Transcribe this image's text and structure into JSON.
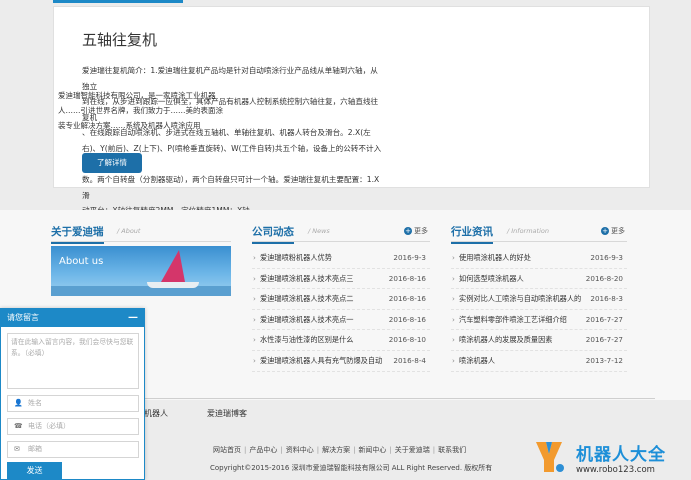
{
  "product": {
    "title": "五轴往复机",
    "description": "爱迪瑞往复机简介：1.爱迪瑞往复机产品均是针对自动喷涂行业产品线从单轴到六轴，从独立\n到在线，从步进到跟踪一应俱全，具体产品有机器人控制系统控制六轴往复，六轴直线往复机\n、在线跟踪自动喷涂机、步进式在线五轴机、单轴往复机、机器人转台及滑台。2.X(左\n右)、Y(前后)、Z(上下)、P(喷枪垂直旋转)、W(工件自转)共五个轴，设备上的公转不计入轴\n数。两个自转盘（分割器驱动），两个自转盘只可计一个轴。爱迪瑞往复机主要配置：1.X滑\n动平台：X轴往复精度2MM，定位精度1MM；X轴...",
    "button": "了解详情"
  },
  "columns": {
    "about": {
      "title": "关于爱迪瑞",
      "en": "/ About",
      "image_caption": "About us",
      "text": "爱迪瑞智能科技有限公司，是一家喷涂工业机器人……引进世界名牌，我们致力于……美的表面涂装专业解决方案……系统及机器人喷涂应用"
    },
    "company_news": {
      "title": "公司动态",
      "en": "/ News",
      "more": "更多",
      "items": [
        {
          "title": "爱迪瑞喷粉机器人优势",
          "date": "2016-9-3"
        },
        {
          "title": "爱迪瑞喷涂机器人技术亮点三",
          "date": "2016-8-16"
        },
        {
          "title": "爱迪瑞喷涂机器人技术亮点二",
          "date": "2016-8-16"
        },
        {
          "title": "爱迪瑞喷涂机器人技术亮点一",
          "date": "2016-8-16"
        },
        {
          "title": "水性漆与油性漆的区别是什么",
          "date": "2016-8-10"
        },
        {
          "title": "爱迪瑞喷涂机器人具有充气防爆及自动",
          "date": "2016-8-4"
        }
      ]
    },
    "industry_news": {
      "title": "行业资讯",
      "en": "/ Information",
      "more": "更多",
      "items": [
        {
          "title": "使用喷涂机器人的好处",
          "date": "2016-9-3"
        },
        {
          "title": "如何选型喷涂机器人",
          "date": "2016-8-20"
        },
        {
          "title": "实例对比人工喷涂与自动喷涂机器人的",
          "date": "2016-8-3"
        },
        {
          "title": "汽车塑料零部件喷涂工艺详细介绍",
          "date": "2016-7-27"
        },
        {
          "title": "喷涂机器人的发展及质量因素",
          "date": "2016-7-27"
        },
        {
          "title": "喷涂机器人",
          "date": "2013-7-12"
        }
      ]
    }
  },
  "links": [
    "机器人",
    "爱迪瑞博客"
  ],
  "footer": {
    "nav": [
      "网站首页",
      "产品中心",
      "资料中心",
      "解决方案",
      "新闻中心",
      "关于爱迪瑞",
      "联系我们"
    ],
    "copyright": "Copyright©2015-2016 深圳市爱迪瑞智能科技有限公司 ALL Right Reserved. 版权所有"
  },
  "logo": {
    "name": "机器人大全",
    "url": "www.robo123.com"
  },
  "widget": {
    "title": "请您留言",
    "minimize": "—",
    "textarea_placeholder": "请在此输入留言内容，我们会尽快与您联系。（必填）",
    "name_placeholder": "姓名",
    "phone_placeholder": "电话（必填）",
    "email_placeholder": "邮箱",
    "send": "发送"
  }
}
